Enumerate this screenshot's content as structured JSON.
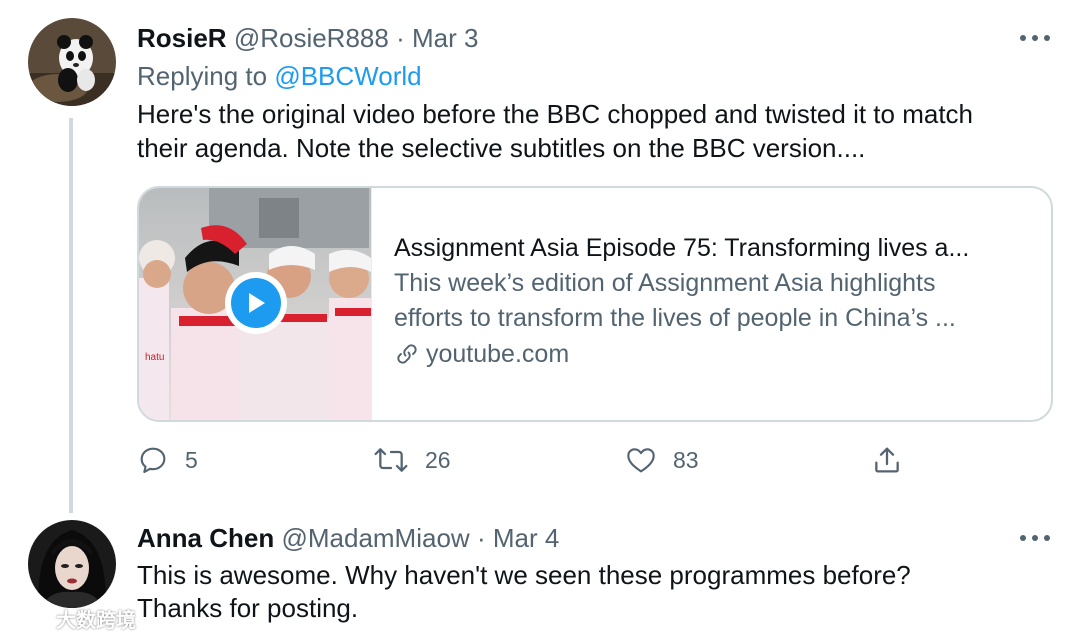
{
  "tweets": [
    {
      "name": "RosieR",
      "handle": "@RosieR888",
      "separator": "·",
      "date": "Mar 3",
      "replying_prefix": "Replying to ",
      "replying_to": "@BBCWorld",
      "body_lines": [
        "Here's the original video before the BBC chopped and twisted it to match",
        "their agenda. Note the selective subtitles on the BBC version...."
      ],
      "card": {
        "title": "Assignment Asia Episode 75: Transforming lives a...",
        "description_lines": [
          "This week’s edition of Assignment Asia highlights",
          "efforts to transform the lives of people in China’s ..."
        ],
        "domain": "youtube.com"
      },
      "actions": {
        "reply_count": "5",
        "retweet_count": "26",
        "like_count": "83"
      }
    },
    {
      "name": "Anna Chen",
      "handle": "@MadamMiaow",
      "separator": "·",
      "date": "Mar 4",
      "body_lines": [
        "This is awesome. Why haven't we seen these programmes before?",
        "Thanks for posting."
      ]
    }
  ],
  "watermark": "大数跨境",
  "icons": [
    "more-icon",
    "reply-icon",
    "retweet-icon",
    "like-icon",
    "share-icon",
    "link-icon",
    "play-icon"
  ],
  "colors": {
    "accent": "#1d9bf0",
    "text": "#0f1419",
    "secondary": "#536471",
    "border": "#cfd9de"
  }
}
